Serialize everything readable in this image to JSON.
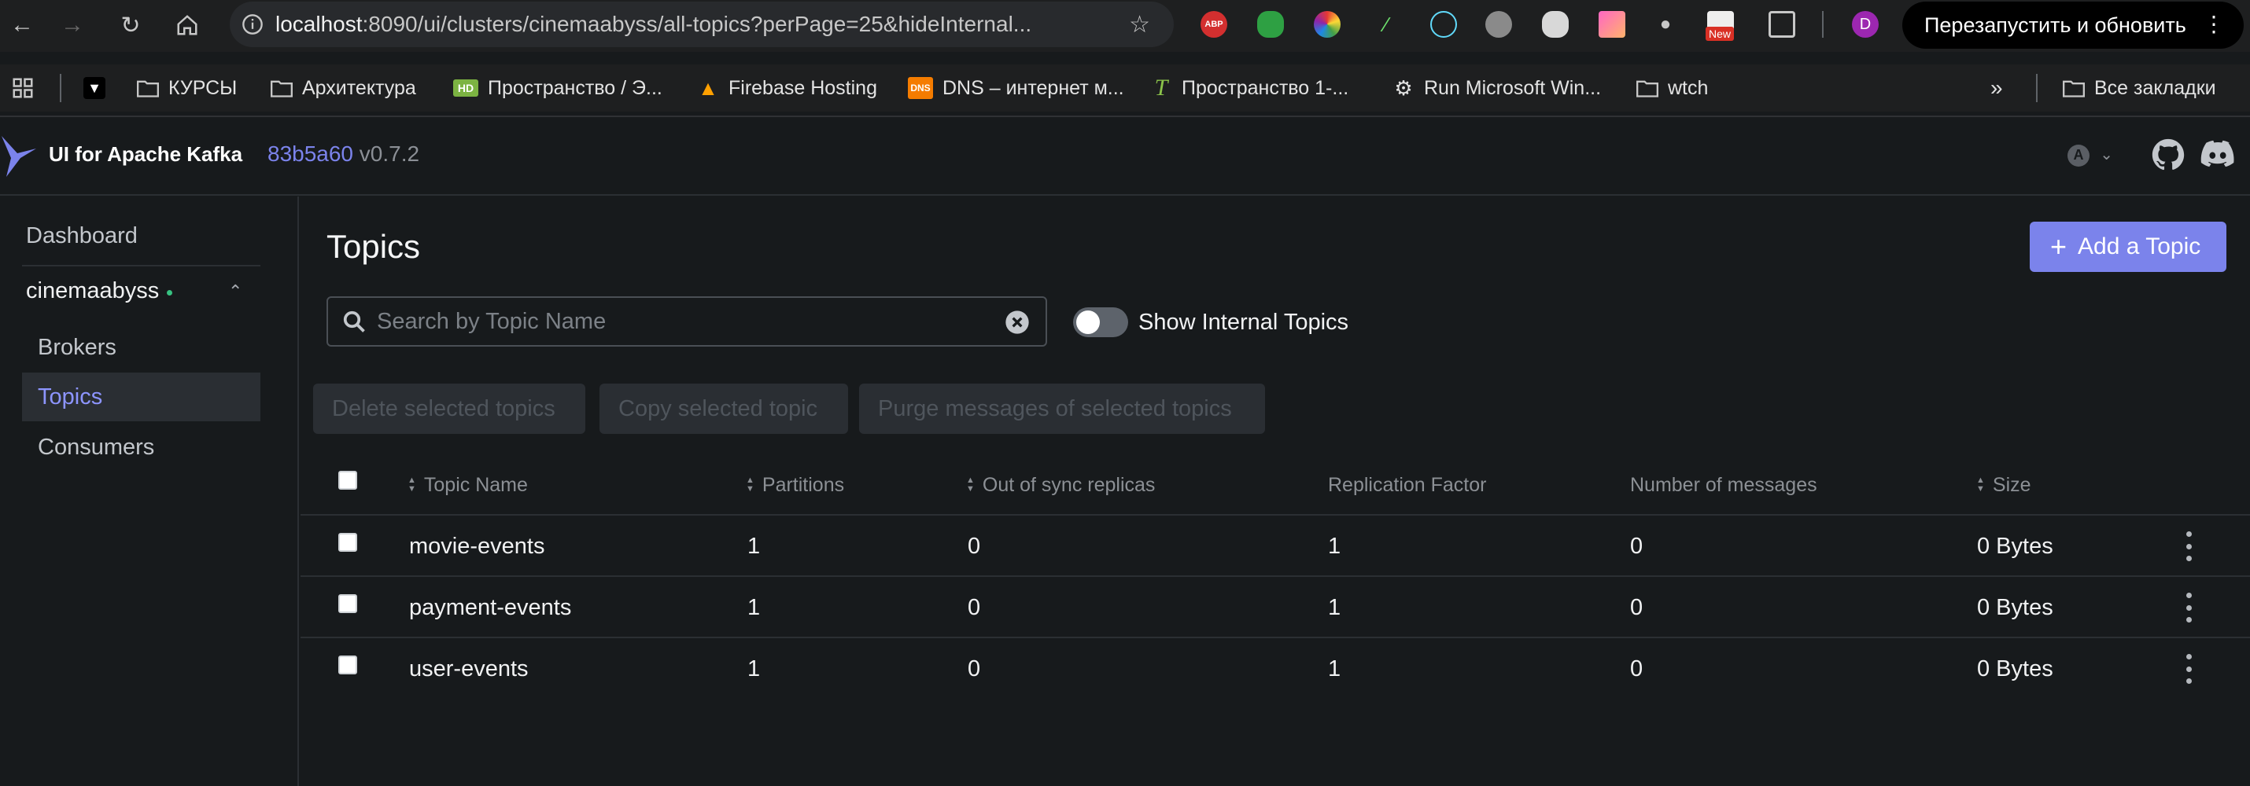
{
  "browser": {
    "url_host": "localhost",
    "url_rest": ":8090/ui/clusters/cinemaabyss/all-topics?perPage=25&hideInternal...",
    "restart_label": "Перезапустить и обновить",
    "profile_initial": "D",
    "ext_new_badge": "New",
    "ext_abp_label": "ABP",
    "bookmarks": [
      {
        "label": "КУРСЫ",
        "icon": "folder-icon"
      },
      {
        "label": "Архитектура",
        "icon": "folder-icon"
      },
      {
        "label": "Пространство / Э...",
        "icon": "hd-icon"
      },
      {
        "label": "Firebase Hosting",
        "icon": "firebase-icon"
      },
      {
        "label": "DNS – интернет м...",
        "icon": "dns-icon"
      },
      {
        "label": "Пространство 1-...",
        "icon": "t-icon"
      },
      {
        "label": "Run Microsoft Win...",
        "icon": "gear-icon"
      },
      {
        "label": "wtch",
        "icon": "folder-icon"
      }
    ],
    "bm_dns_icon_text": "DNS",
    "bm_hd_icon_text": "HD",
    "bm_t_icon_text": "T",
    "all_bookmarks": "Все закладки"
  },
  "header": {
    "brand": "UI for Apache Kafka",
    "version_hash": "83b5a60",
    "version": "v0.7.2",
    "user_initial": "A"
  },
  "sidebar": {
    "dashboard": "Dashboard",
    "cluster": "cinemaabyss",
    "items": [
      "Brokers",
      "Topics",
      "Consumers"
    ]
  },
  "main": {
    "title": "Topics",
    "add_button": "Add a Topic",
    "search_placeholder": "Search by Topic Name",
    "toggle_label": "Show Internal Topics",
    "batch_actions": [
      "Delete selected topics",
      "Copy selected topic",
      "Purge messages of selected topics"
    ]
  },
  "table": {
    "columns": [
      "Topic Name",
      "Partitions",
      "Out of sync replicas",
      "Replication Factor",
      "Number of messages",
      "Size"
    ],
    "rows": [
      {
        "name": "movie-events",
        "partitions": "1",
        "out_of_sync": "0",
        "replication": "1",
        "messages": "0",
        "size": "0 Bytes"
      },
      {
        "name": "payment-events",
        "partitions": "1",
        "out_of_sync": "0",
        "replication": "1",
        "messages": "0",
        "size": "0 Bytes"
      },
      {
        "name": "user-events",
        "partitions": "1",
        "out_of_sync": "0",
        "replication": "1",
        "messages": "0",
        "size": "0 Bytes"
      }
    ]
  },
  "colors": {
    "accent": "#7b83eb",
    "background": "#171a1c",
    "status_online": "#37c281"
  }
}
